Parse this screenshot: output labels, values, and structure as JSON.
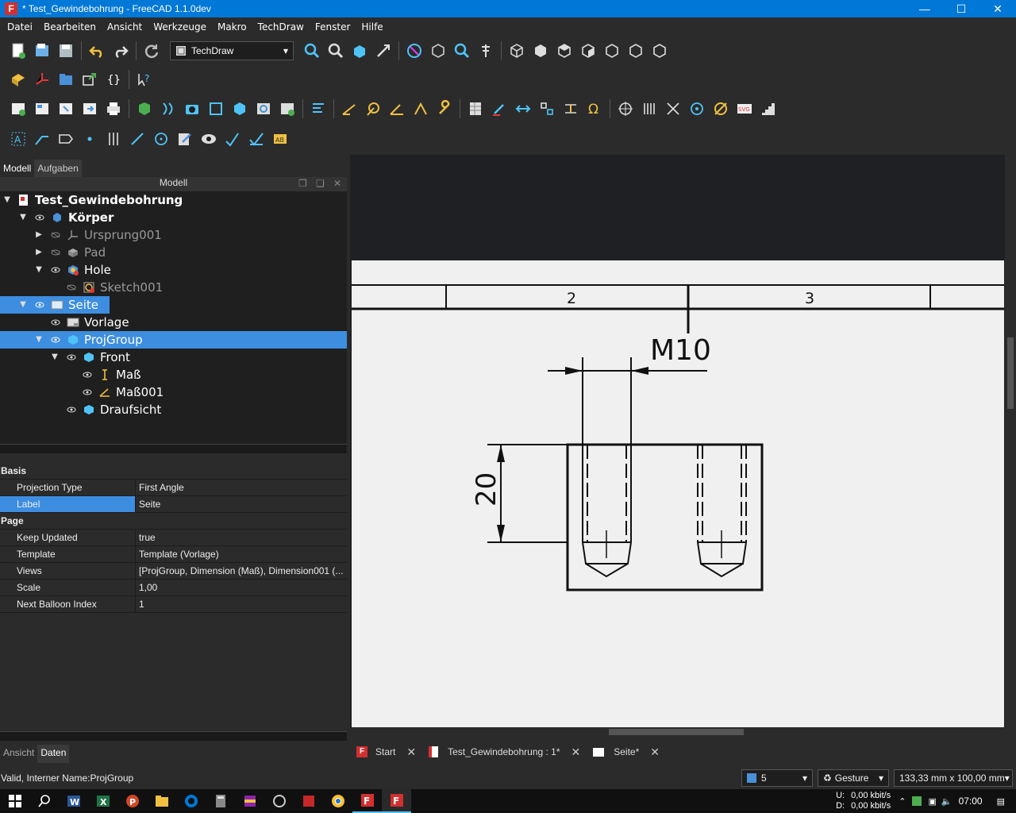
{
  "window": {
    "title": "* Test_Gewindebohrung - FreeCAD 1.1.0dev",
    "controls": [
      "minimize",
      "maximize",
      "close"
    ]
  },
  "menu": [
    "Datei",
    "Bearbeiten",
    "Ansicht",
    "Werkzeuge",
    "Makro",
    "TechDraw",
    "Fenster",
    "Hilfe"
  ],
  "workbench": {
    "selected": "TechDraw"
  },
  "panel": {
    "tabs": {
      "model": "Modell",
      "tasks": "Aufgaben"
    },
    "header": "Modell",
    "tree": [
      {
        "label": "Test_Gewindebohrung"
      },
      {
        "label": "Körper"
      },
      {
        "label": "Ursprung001"
      },
      {
        "label": "Pad"
      },
      {
        "label": "Hole"
      },
      {
        "label": "Sketch001"
      },
      {
        "label": "Seite"
      },
      {
        "label": "Vorlage"
      },
      {
        "label": "ProjGroup"
      },
      {
        "label": "Front"
      },
      {
        "label": "Maß"
      },
      {
        "label": "Maß001"
      },
      {
        "label": "Draufsicht"
      }
    ],
    "properties": {
      "group_basis": "Basis",
      "projection_type_key": "Projection Type",
      "projection_type_val": "First Angle",
      "label_key": "Label",
      "label_val": "Seite",
      "group_page": "Page",
      "keep_updated_key": "Keep Updated",
      "keep_updated_val": "true",
      "template_key": "Template",
      "template_val": "Template (Vorlage)",
      "views_key": "Views",
      "views_val": "[ProjGroup, Dimension (Maß), Dimension001 (...",
      "scale_key": "Scale",
      "scale_val": "1,00",
      "next_balloon_key": "Next Balloon Index",
      "next_balloon_val": "1"
    },
    "bottom_tabs": {
      "view": "Ansicht",
      "data": "Daten"
    }
  },
  "drawing": {
    "zone_2": "2",
    "zone_3": "3",
    "thread_dim": "M10",
    "depth_dim": "20"
  },
  "view_tabs": [
    {
      "label": "Start"
    },
    {
      "label": "Test_Gewindebohrung : 1*"
    },
    {
      "label": "Seite*"
    }
  ],
  "status": {
    "message": "Valid, Interner Name:ProjGroup",
    "count": "5",
    "nav_style": "Gesture",
    "dimensions": "133,33 mm x 100,00 mm"
  },
  "tray": {
    "upload_label": "U:",
    "download_label": "D:",
    "upload": "0,00 kbit/s",
    "download": "0,00 kbit/s",
    "time": "07:00"
  },
  "colors": {
    "accent": "#0078d7",
    "selection": "#3d8ee0",
    "background": "#2b2b2b",
    "paper": "#f0f0f0"
  }
}
